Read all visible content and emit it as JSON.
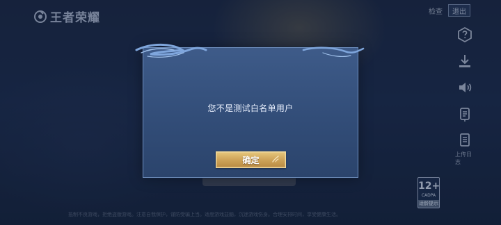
{
  "header": {
    "logo_text": "王者荣耀",
    "announcement_label": "检查",
    "logout_label": "退出"
  },
  "sidebar": {
    "icons": [
      {
        "name": "help-icon"
      },
      {
        "name": "download-icon"
      },
      {
        "name": "speaker-icon"
      },
      {
        "name": "repair-icon"
      },
      {
        "name": "log-upload-icon"
      }
    ],
    "log_label": "上传日志"
  },
  "age_rating": {
    "main": "12+",
    "sub": "CADPA",
    "bottom": "适龄提示"
  },
  "footer": {
    "text": "抵制不良游戏，拒绝盗版游戏。注意自我保护，谨防受骗上当。适度游戏益脑，沉迷游戏伤身。合理安排时间，享受健康生活。"
  },
  "dialog": {
    "message": "您不是测试白名单用户",
    "confirm_label": "确定"
  },
  "colors": {
    "dialog_bg": "#3a5684",
    "dialog_border": "#6f8fbe",
    "button_gold": "#cfa55a",
    "text_light": "#e7eefc"
  }
}
